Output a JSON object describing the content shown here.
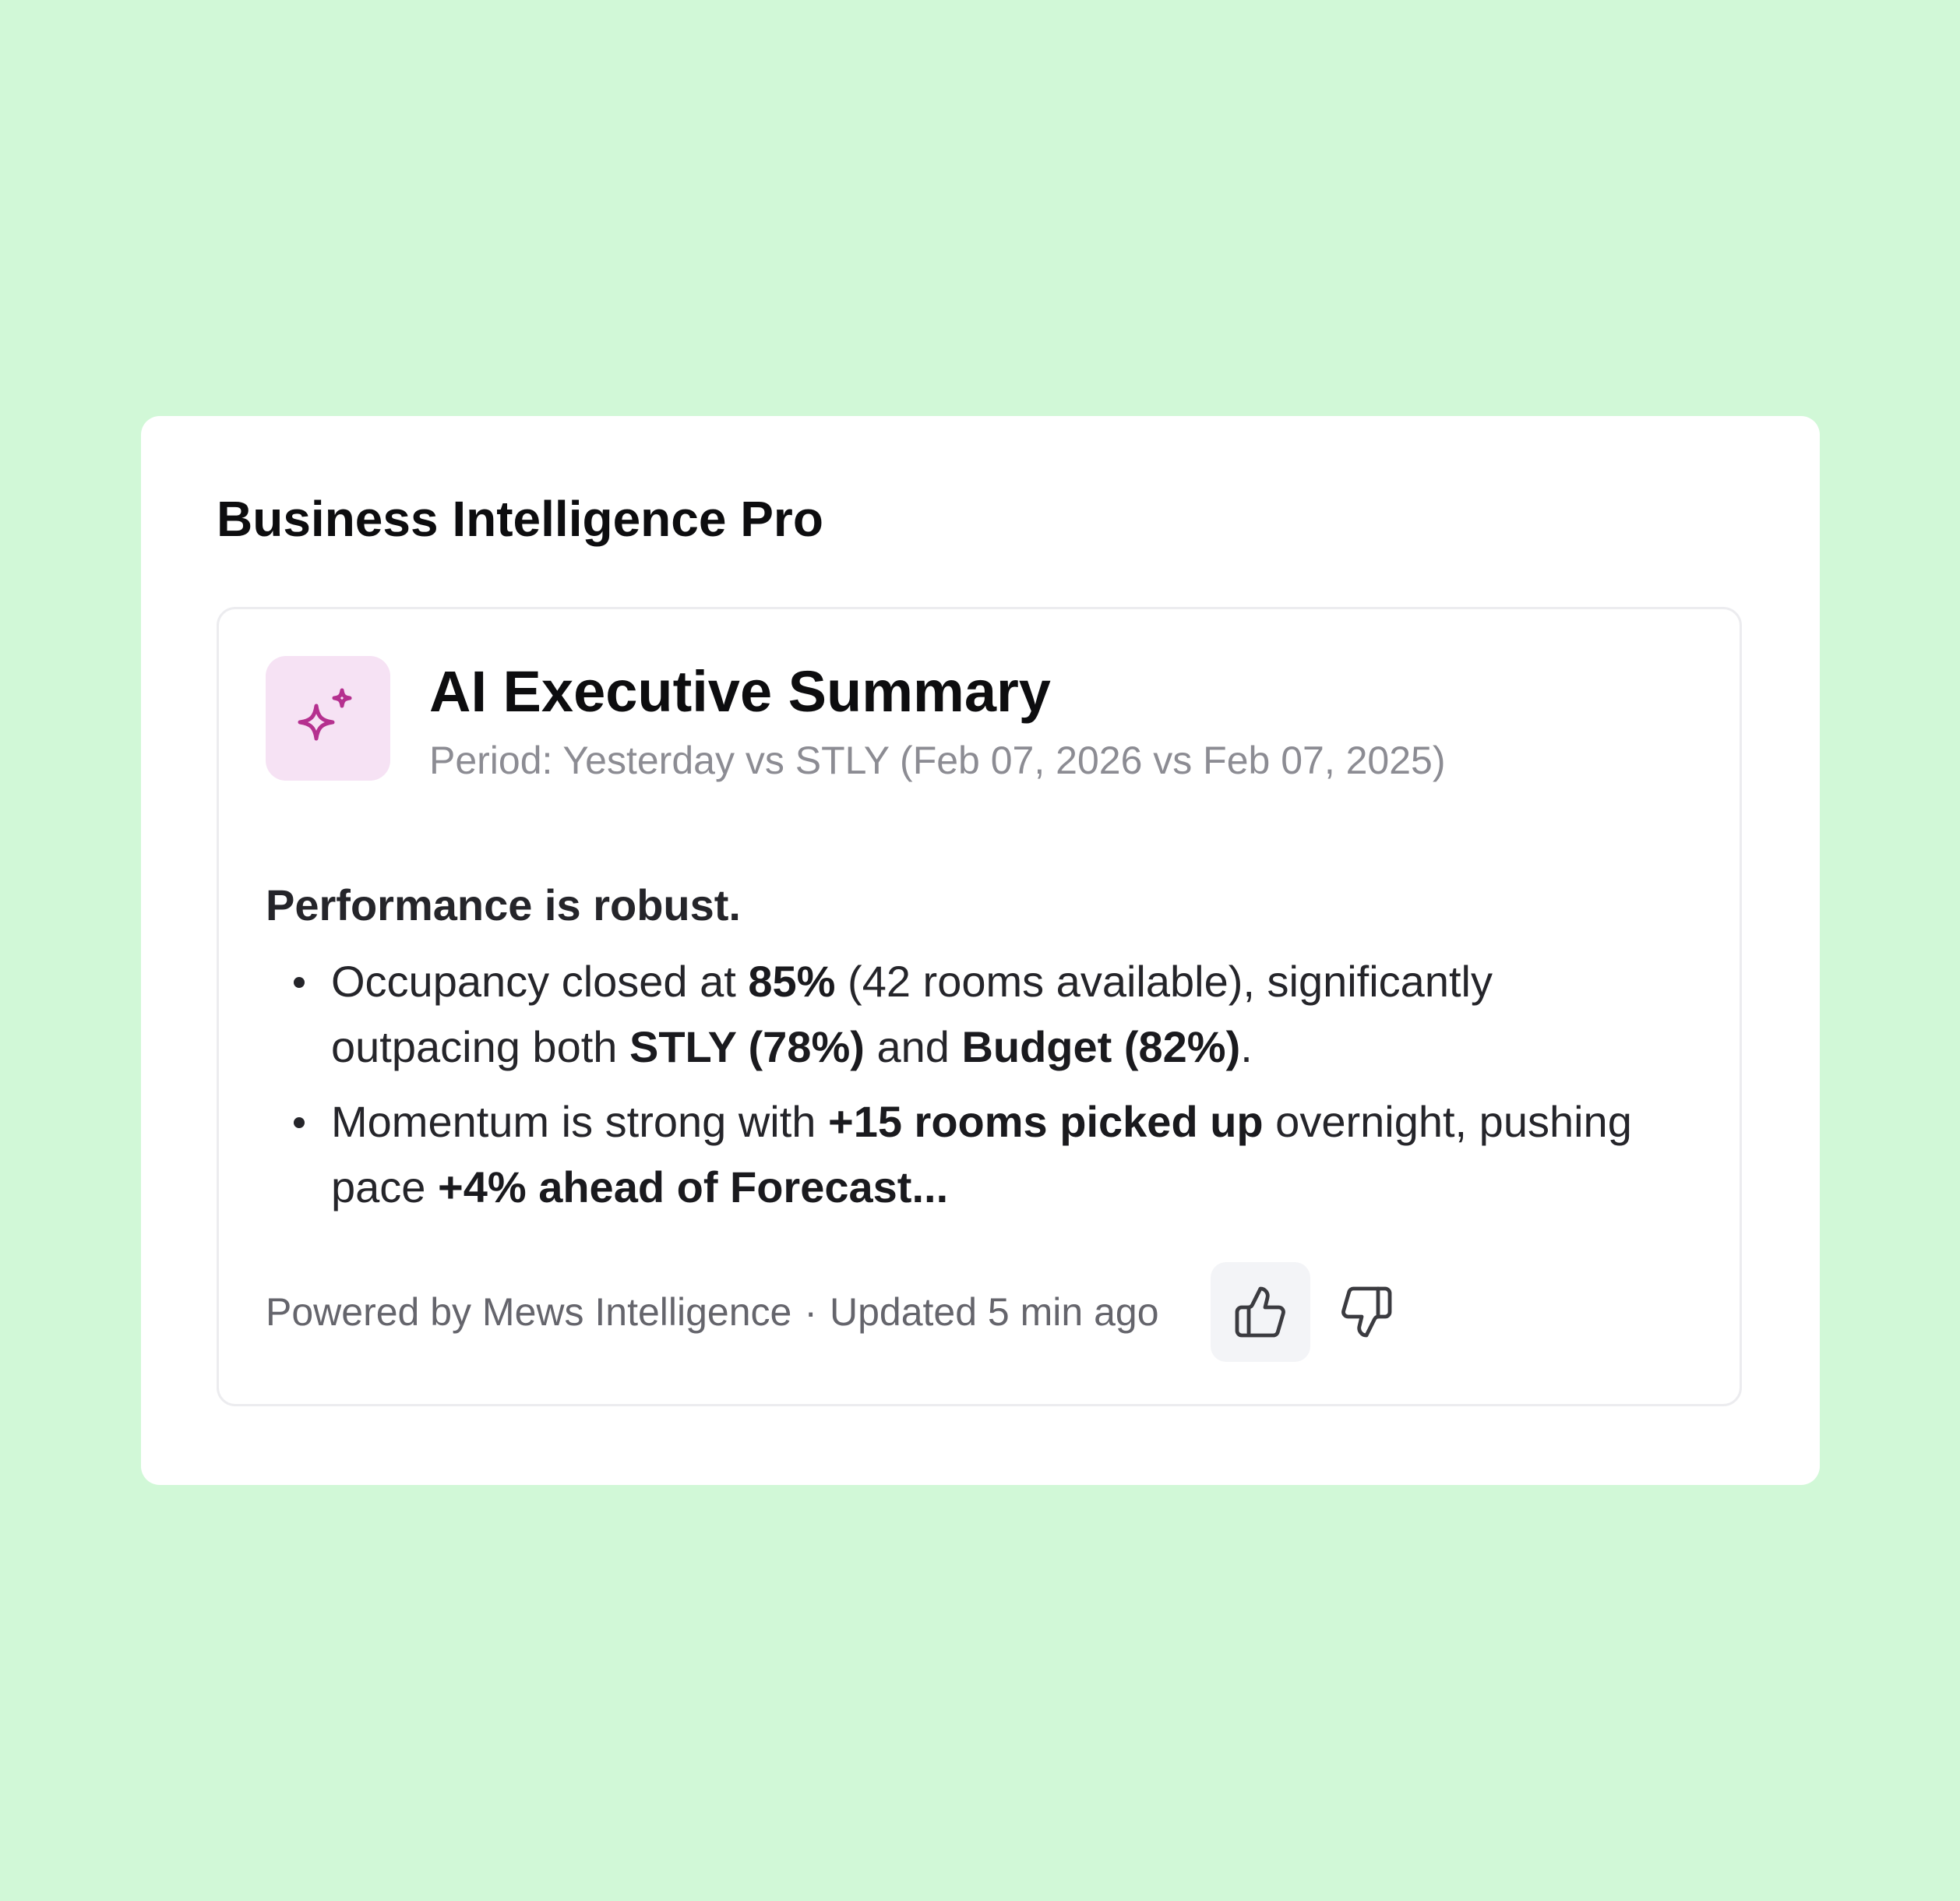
{
  "app": {
    "title": "Business Intelligence Pro"
  },
  "summary": {
    "icon": "sparkles-icon",
    "title": "AI Executive Summary",
    "period": "Period: Yesterday vs STLY (Feb 07, 2026 vs Feb 07, 2025)",
    "lead": "Performance is robust.",
    "bullet_1": {
      "t1": "Occupancy closed at ",
      "b1": "85%",
      "t2": " (42 rooms available), significantly outpacing both ",
      "b2": "STLY (78%)",
      "t3": " and ",
      "b3": "Budget (82%)",
      "t4": "."
    },
    "bullet_2": {
      "t1": "Momentum is strong with ",
      "b1": "+15 rooms picked up",
      "t2": " overnight, pushing pace ",
      "b2": "+4% ahead of Forecast..."
    }
  },
  "footer": {
    "powered_by": "Powered by Mews Intelligence",
    "separator": "·",
    "updated": "Updated 5 min ago"
  },
  "feedback": {
    "thumbs_up_icon": "thumbs-up-icon",
    "thumbs_down_icon": "thumbs-down-icon"
  },
  "colors": {
    "background": "#d1f8d7",
    "card": "#ffffff",
    "icon_tile": "#f6e2f4",
    "icon_accent": "#b5308f",
    "muted_text": "#8c8c93"
  }
}
